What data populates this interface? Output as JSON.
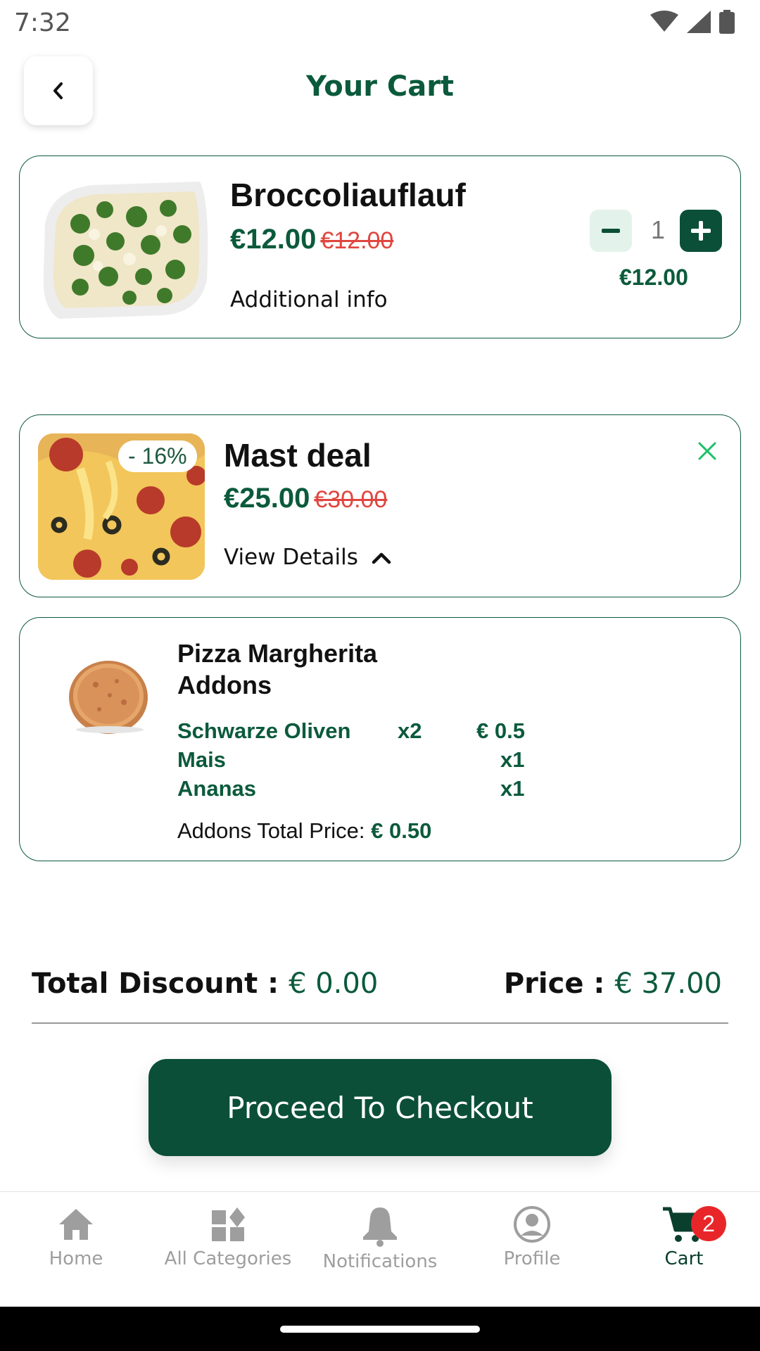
{
  "status_bar": {
    "time": "7:32"
  },
  "header": {
    "title": "Your Cart"
  },
  "cart_items": [
    {
      "name": "Broccoliauflauf",
      "price": "€12.00",
      "old_price": "€12.00",
      "link": "Additional info",
      "quantity": "1",
      "line_total": "€12.00"
    },
    {
      "name": "Mast deal",
      "price": "€25.00",
      "old_price": "€30.00",
      "discount_badge": "- 16%",
      "link": "View Details"
    }
  ],
  "deal_detail": {
    "item_name": "Pizza Margherita",
    "addons_heading": "Addons",
    "addons": [
      {
        "name": "Schwarze Oliven",
        "qty": "x2",
        "price": "€ 0.5"
      },
      {
        "name": "Mais",
        "qty": "x1",
        "price": ""
      },
      {
        "name": "Ananas",
        "qty": "x1",
        "price": ""
      }
    ],
    "addons_total_label": "Addons Total Price:",
    "addons_total_value": "€ 0.50"
  },
  "totals": {
    "discount_label": "Total Discount :",
    "discount_value": "€ 0.00",
    "price_label": "Price :",
    "price_value": "€ 37.00"
  },
  "checkout_label": "Proceed To Checkout",
  "bottom_nav": [
    {
      "label": "Home",
      "icon": "home-icon"
    },
    {
      "label": "All Categories",
      "icon": "categories-icon"
    },
    {
      "label": "Notifications",
      "icon": "bell-icon"
    },
    {
      "label": "Profile",
      "icon": "profile-icon"
    },
    {
      "label": "Cart",
      "icon": "cart-icon",
      "badge": "2",
      "active": true
    }
  ],
  "colors": {
    "brand": "#0b4f38",
    "accent_text": "#0b5a3c",
    "strike": "#e0463f",
    "badge": "#e8262a"
  }
}
